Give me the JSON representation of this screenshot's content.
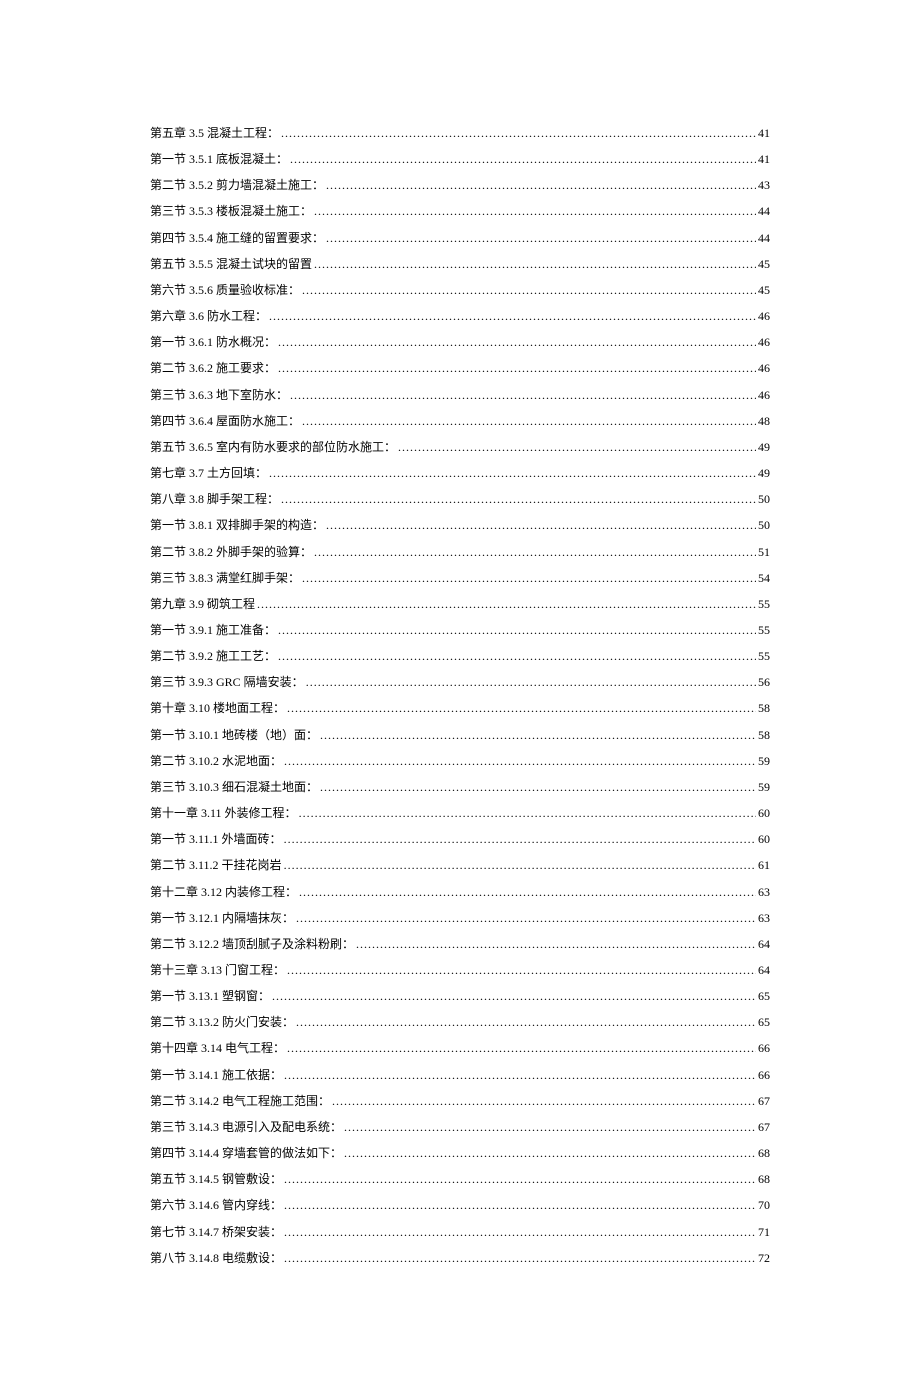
{
  "toc": [
    {
      "title": "第五章 3.5 混凝土工程：",
      "page": "41"
    },
    {
      "title": "第一节 3.5.1 底板混凝土：",
      "page": "41"
    },
    {
      "title": "第二节 3.5.2 剪力墙混凝土施工：",
      "page": "43"
    },
    {
      "title": "第三节 3.5.3 楼板混凝土施工：",
      "page": "44"
    },
    {
      "title": "第四节 3.5.4 施工缝的留置要求：",
      "page": "44"
    },
    {
      "title": "第五节 3.5.5 混凝土试块的留置",
      "page": "45"
    },
    {
      "title": "第六节 3.5.6 质量验收标准：",
      "page": "45"
    },
    {
      "title": "第六章 3.6 防水工程：",
      "page": "46"
    },
    {
      "title": "第一节 3.6.1 防水概况：",
      "page": "46"
    },
    {
      "title": "第二节 3.6.2 施工要求：",
      "page": "46"
    },
    {
      "title": "第三节 3.6.3 地下室防水：",
      "page": "46"
    },
    {
      "title": "第四节 3.6.4 屋面防水施工：",
      "page": "48"
    },
    {
      "title": "第五节 3.6.5 室内有防水要求的部位防水施工：",
      "page": "49"
    },
    {
      "title": "第七章 3.7 土方回填：",
      "page": "49"
    },
    {
      "title": "第八章 3.8 脚手架工程：",
      "page": "50"
    },
    {
      "title": "第一节 3.8.1 双排脚手架的构造：",
      "page": "50"
    },
    {
      "title": "第二节 3.8.2 外脚手架的验算：",
      "page": "51"
    },
    {
      "title": "第三节 3.8.3 满堂红脚手架：",
      "page": "54"
    },
    {
      "title": "第九章 3.9 砌筑工程",
      "page": "55"
    },
    {
      "title": "第一节 3.9.1 施工准备：",
      "page": "55"
    },
    {
      "title": "第二节 3.9.2 施工工艺：",
      "page": "55"
    },
    {
      "title": "第三节 3.9.3 GRC 隔墙安装：",
      "page": "56"
    },
    {
      "title": "第十章 3.10 楼地面工程：",
      "page": "58"
    },
    {
      "title": "第一节 3.10.1 地砖楼（地）面：",
      "page": "58"
    },
    {
      "title": "第二节 3.10.2 水泥地面：",
      "page": "59"
    },
    {
      "title": "第三节 3.10.3 细石混凝土地面：",
      "page": "59"
    },
    {
      "title": "第十一章 3.11 外装修工程：",
      "page": "60"
    },
    {
      "title": "第一节 3.11.1 外墙面砖：",
      "page": "60"
    },
    {
      "title": "第二节 3.11.2 干挂花岗岩",
      "page": "61"
    },
    {
      "title": "第十二章 3.12 内装修工程：",
      "page": "63"
    },
    {
      "title": "第一节 3.12.1 内隔墙抹灰：",
      "page": "63"
    },
    {
      "title": "第二节 3.12.2 墙顶刮腻子及涂料粉刷：",
      "page": "64"
    },
    {
      "title": "第十三章 3.13 门窗工程：",
      "page": "64"
    },
    {
      "title": "第一节 3.13.1 塑钢窗：",
      "page": "65"
    },
    {
      "title": "第二节 3.13.2 防火门安装：",
      "page": "65"
    },
    {
      "title": "第十四章 3.14 电气工程：",
      "page": "66"
    },
    {
      "title": "第一节 3.14.1 施工依据：",
      "page": "66"
    },
    {
      "title": "第二节 3.14.2 电气工程施工范围：",
      "page": "67"
    },
    {
      "title": "第三节 3.14.3 电源引入及配电系统：",
      "page": "67"
    },
    {
      "title": "第四节 3.14.4 穿墙套管的做法如下：",
      "page": "68"
    },
    {
      "title": "第五节 3.14.5 钢管敷设：",
      "page": "68"
    },
    {
      "title": "第六节 3.14.6 管内穿线：",
      "page": "70"
    },
    {
      "title": "第七节 3.14.7 桥架安装：",
      "page": "71"
    },
    {
      "title": "第八节 3.14.8 电缆敷设：",
      "page": "72"
    }
  ]
}
